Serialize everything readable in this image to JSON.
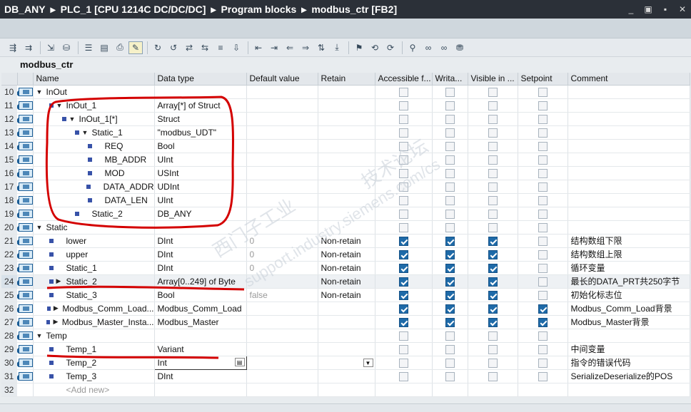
{
  "breadcrumb": {
    "items": [
      "DB_ANY",
      "PLC_1 [CPU 1214C DC/DC/DC]",
      "Program blocks",
      "modbus_ctr [FB2]"
    ],
    "separator": "▸"
  },
  "window_buttons": [
    "_",
    "▣",
    "▪",
    "✕"
  ],
  "block_name": "modbus_ctr",
  "columns": [
    "Name",
    "Data type",
    "Default value",
    "Retain",
    "Accessible f...",
    "Writa...",
    "Visible in ...",
    "Setpoint",
    "Comment"
  ],
  "rows": [
    {
      "n": "10",
      "level": 0,
      "expand": "down",
      "name": "InOut",
      "type": "",
      "default": "",
      "retain": "",
      "acc": false,
      "wr": false,
      "vis": false,
      "sp": false,
      "comment": "",
      "sec": true
    },
    {
      "n": "11",
      "level": 1,
      "expand": "down",
      "name": "InOut_1",
      "type": "Array[*] of Struct",
      "default": "",
      "retain": "",
      "acc": false,
      "wr": false,
      "vis": false,
      "sp": false,
      "comment": ""
    },
    {
      "n": "12",
      "level": 2,
      "expand": "down",
      "name": "InOut_1[*]",
      "type": "Struct",
      "default": "",
      "retain": "",
      "acc": false,
      "wr": false,
      "vis": false,
      "sp": false,
      "comment": ""
    },
    {
      "n": "13",
      "level": 3,
      "expand": "down",
      "name": "Static_1",
      "type": "\"modbus_UDT\"",
      "default": "",
      "retain": "",
      "acc": false,
      "wr": false,
      "vis": false,
      "sp": false,
      "comment": ""
    },
    {
      "n": "14",
      "level": 4,
      "expand": "",
      "name": "REQ",
      "type": "Bool",
      "default": "",
      "retain": "",
      "acc": false,
      "wr": false,
      "vis": false,
      "sp": false,
      "comment": ""
    },
    {
      "n": "15",
      "level": 4,
      "expand": "",
      "name": "MB_ADDR",
      "type": "UInt",
      "default": "",
      "retain": "",
      "acc": false,
      "wr": false,
      "vis": false,
      "sp": false,
      "comment": ""
    },
    {
      "n": "16",
      "level": 4,
      "expand": "",
      "name": "MOD",
      "type": "USInt",
      "default": "",
      "retain": "",
      "acc": false,
      "wr": false,
      "vis": false,
      "sp": false,
      "comment": ""
    },
    {
      "n": "17",
      "level": 4,
      "expand": "",
      "name": "DATA_ADDR",
      "type": "UDInt",
      "default": "",
      "retain": "",
      "acc": false,
      "wr": false,
      "vis": false,
      "sp": false,
      "comment": ""
    },
    {
      "n": "18",
      "level": 4,
      "expand": "",
      "name": "DATA_LEN",
      "type": "UInt",
      "default": "",
      "retain": "",
      "acc": false,
      "wr": false,
      "vis": false,
      "sp": false,
      "comment": ""
    },
    {
      "n": "19",
      "level": 3,
      "expand": "",
      "name": "Static_2",
      "type": "DB_ANY",
      "default": "",
      "retain": "",
      "acc": false,
      "wr": false,
      "vis": false,
      "sp": false,
      "comment": ""
    },
    {
      "n": "20",
      "level": 0,
      "expand": "down",
      "name": "Static",
      "type": "",
      "default": "",
      "retain": "",
      "acc": false,
      "wr": false,
      "vis": false,
      "sp": false,
      "comment": "",
      "sec": true
    },
    {
      "n": "21",
      "level": 1,
      "expand": "",
      "name": "lower",
      "type": "DInt",
      "default": "0",
      "retain": "Non-retain",
      "acc": true,
      "wr": true,
      "vis": true,
      "sp": false,
      "comment": "结构数组下限"
    },
    {
      "n": "22",
      "level": 1,
      "expand": "",
      "name": "upper",
      "type": "DInt",
      "default": "0",
      "retain": "Non-retain",
      "acc": true,
      "wr": true,
      "vis": true,
      "sp": false,
      "comment": "结构数组上限"
    },
    {
      "n": "23",
      "level": 1,
      "expand": "",
      "name": "Static_1",
      "type": "DInt",
      "default": "0",
      "retain": "Non-retain",
      "acc": true,
      "wr": true,
      "vis": true,
      "sp": false,
      "comment": "循环变量"
    },
    {
      "n": "24",
      "level": 1,
      "expand": "right",
      "name": "Static_2",
      "type": "Array[0..249] of Byte",
      "default": "",
      "retain": "Non-retain",
      "acc": true,
      "wr": true,
      "vis": true,
      "sp": false,
      "comment": "最长的DATA_PRT共250字节",
      "sel": true
    },
    {
      "n": "25",
      "level": 1,
      "expand": "",
      "name": "Static_3",
      "type": "Bool",
      "default": "false",
      "retain": "Non-retain",
      "acc": true,
      "wr": true,
      "vis": true,
      "sp": false,
      "comment": "初始化标志位"
    },
    {
      "n": "26",
      "level": 1,
      "expand": "right",
      "name": "Modbus_Comm_Load...",
      "type": "Modbus_Comm_Load",
      "default": "",
      "retain": "",
      "acc": true,
      "wr": true,
      "vis": true,
      "sp": true,
      "comment": "Modbus_Comm_Load背景"
    },
    {
      "n": "27",
      "level": 1,
      "expand": "right",
      "name": "Modbus_Master_Insta...",
      "type": "Modbus_Master",
      "default": "",
      "retain": "",
      "acc": true,
      "wr": true,
      "vis": true,
      "sp": true,
      "comment": "Modbus_Master背景"
    },
    {
      "n": "28",
      "level": 0,
      "expand": "down",
      "name": "Temp",
      "type": "",
      "default": "",
      "retain": "",
      "acc": false,
      "wr": false,
      "vis": false,
      "sp": false,
      "comment": "",
      "sec": true
    },
    {
      "n": "29",
      "level": 1,
      "expand": "",
      "name": "Temp_1",
      "type": "Variant",
      "default": "",
      "retain": "",
      "acc": false,
      "wr": false,
      "vis": false,
      "sp": false,
      "comment": "中间变量"
    },
    {
      "n": "30",
      "level": 1,
      "expand": "",
      "name": "Temp_2",
      "type": "Int",
      "default": "",
      "retain": "",
      "acc": false,
      "wr": false,
      "vis": false,
      "sp": false,
      "comment": "指令的错误代码",
      "edit": true
    },
    {
      "n": "31",
      "level": 1,
      "expand": "",
      "name": "Temp_3",
      "type": "DInt",
      "default": "",
      "retain": "",
      "acc": false,
      "wr": false,
      "vis": false,
      "sp": false,
      "comment": "SerializeDeserialize的POS"
    },
    {
      "n": "32",
      "level": 1,
      "expand": "",
      "name": "<Add new>",
      "type": "",
      "default": "",
      "retain": "",
      "acc": false,
      "wr": false,
      "vis": false,
      "sp": false,
      "comment": "",
      "addnew": true
    }
  ],
  "watermarks": [
    "西门子工业",
    "技术论坛",
    "support.industry.siemens.com/cs"
  ],
  "colors": {
    "titlebar": "#2b3038",
    "checked": "#1e6aa8",
    "annotation": "#d40000"
  }
}
